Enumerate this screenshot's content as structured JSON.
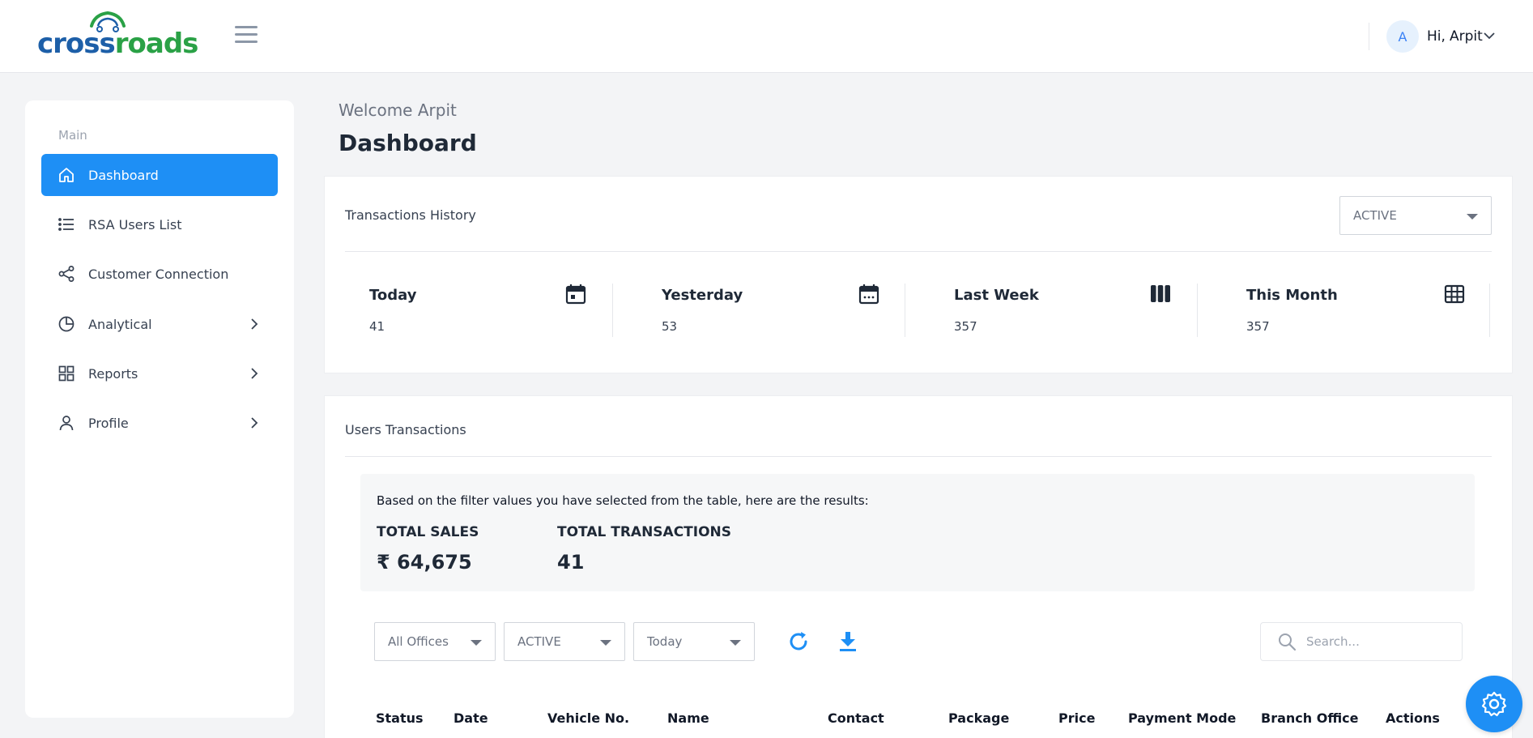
{
  "brand": {
    "logo_part1": "cross",
    "logo_part2": "roads",
    "colors": {
      "primary": "#1e8ff5",
      "logo_blue": "#1d5fa8",
      "logo_green": "#2aa146"
    }
  },
  "header": {
    "avatar_initial": "A",
    "greeting": "Hi,",
    "user_name": "Arpit"
  },
  "sidebar": {
    "heading": "Main",
    "items": [
      {
        "label": "Dashboard",
        "icon": "home-icon",
        "active": true,
        "has_children": false
      },
      {
        "label": "RSA Users List",
        "icon": "list-icon",
        "active": false,
        "has_children": false
      },
      {
        "label": "Customer Connection",
        "icon": "share-icon",
        "active": false,
        "has_children": false
      },
      {
        "label": "Analytical",
        "icon": "pie-chart-icon",
        "active": false,
        "has_children": true
      },
      {
        "label": "Reports",
        "icon": "grid-icon",
        "active": false,
        "has_children": true
      },
      {
        "label": "Profile",
        "icon": "user-icon",
        "active": false,
        "has_children": true
      }
    ]
  },
  "main": {
    "welcome": "Welcome Arpit",
    "title": "Dashboard"
  },
  "transactions_history": {
    "title": "Transactions History",
    "status_select": "ACTIVE",
    "stats": [
      {
        "label": "Today",
        "value": "41",
        "icon": "calendar-icon"
      },
      {
        "label": "Yesterday",
        "value": "53",
        "icon": "calendar-icon"
      },
      {
        "label": "Last Week",
        "value": "357",
        "icon": "columns-icon"
      },
      {
        "label": "This Month",
        "value": "357",
        "icon": "table-icon"
      }
    ]
  },
  "users_transactions": {
    "title": "Users Transactions",
    "filter_note": "Based on the filter values you have selected from the table, here are the results:",
    "total_sales_label": "TOTAL SALES",
    "total_sales_value": "₹ 64,675",
    "total_transactions_label": "TOTAL TRANSACTIONS",
    "total_transactions_value": "41",
    "filters": {
      "office": "All Offices",
      "status": "ACTIVE",
      "period": "Today"
    },
    "search_placeholder": "Search...",
    "columns": [
      "Status",
      "Date",
      "Vehicle No.",
      "Name",
      "Contact",
      "Package",
      "Price",
      "Payment Mode",
      "Branch Office",
      "Actions"
    ]
  }
}
